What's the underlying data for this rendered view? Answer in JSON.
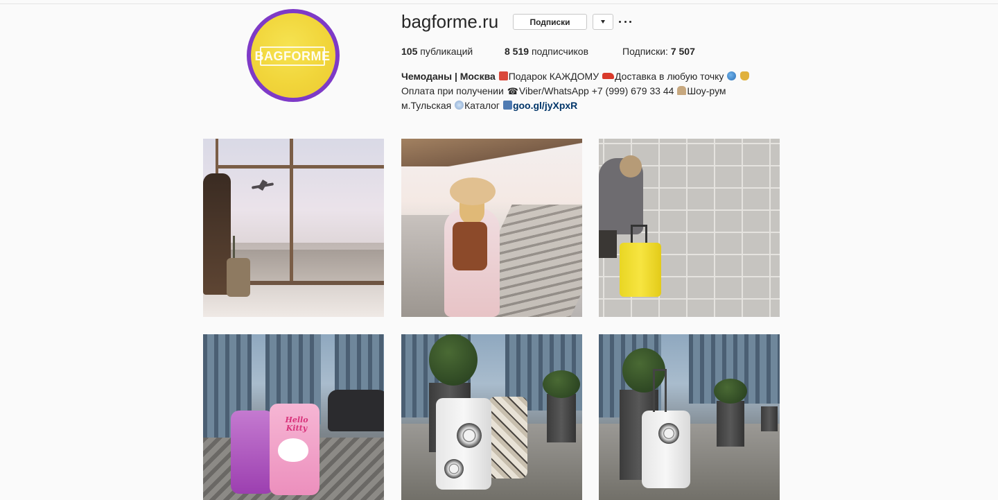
{
  "profile": {
    "username": "bagforme.ru",
    "avatar_text": "BAGFORME",
    "follow_button_label": "Подписки",
    "stats": {
      "posts_count": "105",
      "posts_label": "публикаций",
      "followers_count": "8 519",
      "followers_label": "подписчиков",
      "following_label": "Подписки:",
      "following_count": "7 507"
    },
    "bio": {
      "name": "Чемоданы | Москва",
      "line1_a": "Подарок КАЖДОМУ",
      "line1_b": "Доставка в любую точку",
      "line2_a": "Оплата при получении",
      "line2_b": "Viber/WhatsApp +7 (999) 679 33 44",
      "line2_c": "Шоу-рум",
      "line3_a": "м.Тульская",
      "line3_b": "Каталог",
      "link": "goo.gl/jyXpxR"
    }
  },
  "posts": [
    {
      "subject": "traveler at airport window with suitcase"
    },
    {
      "subject": "woman with backpack at railway platform"
    },
    {
      "subject": "yellow suitcase by tiled wall"
    },
    {
      "subject": "kids suitcases Princess and Hello Kitty"
    },
    {
      "subject": "two printed suitcases in business district"
    },
    {
      "subject": "printed suitcase near plant pots"
    }
  ],
  "tile_texts": {
    "kitty_text": "Hello Kitty"
  },
  "colors": {
    "background": "#fafafa",
    "avatar_ring": "#7e3ac7",
    "avatar_fill": "#f1d53a",
    "link": "#003569",
    "text": "#262626"
  },
  "icons": {
    "dropdown": "chevron-down-icon",
    "more": "more-dots-icon"
  }
}
